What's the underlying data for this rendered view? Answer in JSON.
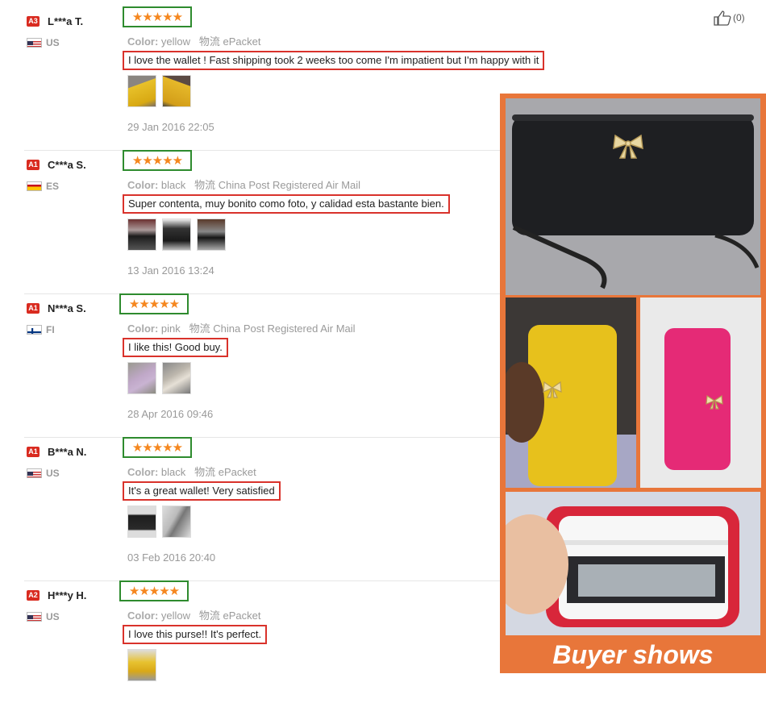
{
  "reviews": [
    {
      "level": "A3",
      "name": "L***a T.",
      "country": "US",
      "stars": "★★★★★",
      "color_label": "Color:",
      "color": "yellow",
      "logistics_label": "物流",
      "shipping": "ePacket",
      "comment": "I love the wallet ! Fast shipping took 2 weeks too come I'm impatient but I'm happy with it",
      "date": "29 Jan 2016 22:05"
    },
    {
      "level": "A1",
      "name": "C***a S.",
      "country": "ES",
      "stars": "★★★★★",
      "color_label": "Color:",
      "color": "black",
      "logistics_label": "物流",
      "shipping": "China Post Registered Air Mail",
      "comment": "Super contenta, muy bonito como foto, y calidad esta bastante bien.",
      "date": "13 Jan 2016 13:24"
    },
    {
      "level": "A1",
      "name": "N***a S.",
      "country": "FI",
      "stars": "★★★★★",
      "color_label": "Color:",
      "color": "pink",
      "logistics_label": "物流",
      "shipping": "China Post Registered Air Mail",
      "comment": "I like this! Good buy.",
      "date": "28 Apr 2016 09:46"
    },
    {
      "level": "A1",
      "name": "B***a N.",
      "country": "US",
      "stars": "★★★★★",
      "color_label": "Color:",
      "color": "black",
      "logistics_label": "物流",
      "shipping": "ePacket",
      "comment": "It's a great wallet! Very satisfied",
      "date": "03 Feb 2016 20:40"
    },
    {
      "level": "A2",
      "name": "H***y H.",
      "country": "US",
      "stars": "★★★★★",
      "color_label": "Color:",
      "color": "yellow",
      "logistics_label": "物流",
      "shipping": "ePacket",
      "comment": "I love this purse!! It's perfect.",
      "date": ""
    }
  ],
  "likes": "(0)",
  "banner": {
    "text": "Buyer shows"
  },
  "colors": {
    "accent_orange": "#e8763a",
    "star": "#f5871f",
    "green_box": "#2e8b2e",
    "red_box": "#d9322b"
  }
}
